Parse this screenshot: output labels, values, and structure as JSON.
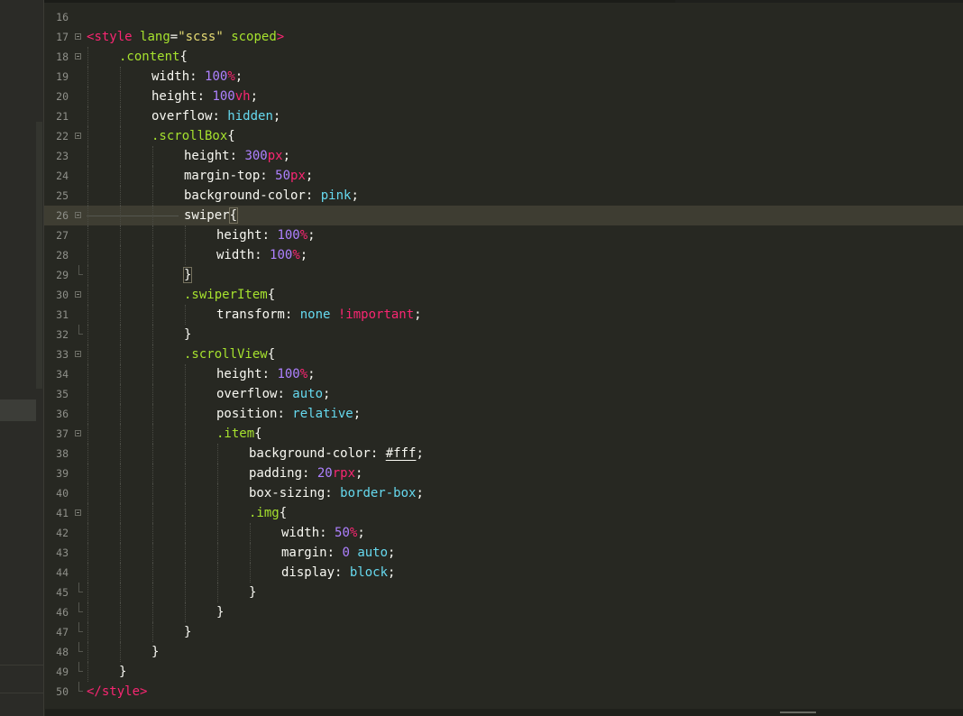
{
  "editor": {
    "current_line": 26,
    "lines": [
      {
        "n": "16",
        "fold": "none",
        "indent": 0,
        "tokens": []
      },
      {
        "n": "17",
        "fold": "open",
        "indent": 0,
        "tokens": [
          [
            "<",
            "t-tag"
          ],
          [
            "style",
            "t-tag"
          ],
          [
            " ",
            ""
          ],
          [
            "lang",
            "t-attr"
          ],
          [
            "=",
            ""
          ],
          [
            "\"scss\"",
            "t-str"
          ],
          [
            " ",
            ""
          ],
          [
            "scoped",
            "t-attr"
          ],
          [
            ">",
            "t-tag"
          ]
        ]
      },
      {
        "n": "18",
        "fold": "open",
        "indent": 1,
        "tokens": [
          [
            ".content",
            "t-sel"
          ],
          [
            "{",
            ""
          ]
        ]
      },
      {
        "n": "19",
        "fold": "none",
        "indent": 2,
        "tokens": [
          [
            "width",
            "t-prop"
          ],
          [
            ": ",
            ""
          ],
          [
            "100",
            "t-num"
          ],
          [
            "%",
            "t-unit"
          ],
          [
            ";",
            ""
          ]
        ]
      },
      {
        "n": "20",
        "fold": "none",
        "indent": 2,
        "tokens": [
          [
            "height",
            "t-prop"
          ],
          [
            ": ",
            ""
          ],
          [
            "100",
            "t-num"
          ],
          [
            "vh",
            "t-unit"
          ],
          [
            ";",
            ""
          ]
        ]
      },
      {
        "n": "21",
        "fold": "none",
        "indent": 2,
        "tokens": [
          [
            "overflow",
            "t-prop"
          ],
          [
            ": ",
            ""
          ],
          [
            "hidden",
            "t-kw"
          ],
          [
            ";",
            ""
          ]
        ]
      },
      {
        "n": "22",
        "fold": "open",
        "indent": 2,
        "tokens": [
          [
            ".scrollBox",
            "t-sel"
          ],
          [
            "{",
            ""
          ]
        ]
      },
      {
        "n": "23",
        "fold": "none",
        "indent": 3,
        "tokens": [
          [
            "height",
            "t-prop"
          ],
          [
            ": ",
            ""
          ],
          [
            "300",
            "t-num"
          ],
          [
            "px",
            "t-unit"
          ],
          [
            ";",
            ""
          ]
        ]
      },
      {
        "n": "24",
        "fold": "none",
        "indent": 3,
        "tokens": [
          [
            "margin-top",
            "t-prop"
          ],
          [
            ": ",
            ""
          ],
          [
            "50",
            "t-num"
          ],
          [
            "px",
            "t-unit"
          ],
          [
            ";",
            ""
          ]
        ]
      },
      {
        "n": "25",
        "fold": "none",
        "indent": 3,
        "tokens": [
          [
            "background-color",
            "t-prop"
          ],
          [
            ": ",
            ""
          ],
          [
            "pink",
            "t-kw"
          ],
          [
            ";",
            ""
          ]
        ]
      },
      {
        "n": "26",
        "fold": "open",
        "indent": 3,
        "tokens": [
          [
            "swiper",
            "t-prop"
          ],
          [
            "{",
            "bracket-box"
          ],
          [
            "",
            "caret"
          ]
        ]
      },
      {
        "n": "27",
        "fold": "none",
        "indent": 4,
        "tokens": [
          [
            "height",
            "t-prop"
          ],
          [
            ": ",
            ""
          ],
          [
            "100",
            "t-num"
          ],
          [
            "%",
            "t-unit"
          ],
          [
            ";",
            ""
          ]
        ]
      },
      {
        "n": "28",
        "fold": "none",
        "indent": 4,
        "tokens": [
          [
            "width",
            "t-prop"
          ],
          [
            ": ",
            ""
          ],
          [
            "100",
            "t-num"
          ],
          [
            "%",
            "t-unit"
          ],
          [
            ";",
            ""
          ]
        ]
      },
      {
        "n": "29",
        "fold": "end",
        "indent": 3,
        "tokens": [
          [
            "}",
            "bracket-box"
          ]
        ]
      },
      {
        "n": "30",
        "fold": "open",
        "indent": 3,
        "tokens": [
          [
            ".swiperItem",
            "t-sel"
          ],
          [
            "{",
            ""
          ]
        ]
      },
      {
        "n": "31",
        "fold": "none",
        "indent": 4,
        "tokens": [
          [
            "transform",
            "t-prop"
          ],
          [
            ": ",
            ""
          ],
          [
            "none",
            "t-kw"
          ],
          [
            " ",
            ""
          ],
          [
            "!important",
            "t-imp"
          ],
          [
            ";",
            ""
          ]
        ]
      },
      {
        "n": "32",
        "fold": "end",
        "indent": 3,
        "tokens": [
          [
            "}",
            ""
          ]
        ]
      },
      {
        "n": "33",
        "fold": "open",
        "indent": 3,
        "tokens": [
          [
            ".scrollView",
            "t-sel"
          ],
          [
            "{",
            ""
          ]
        ]
      },
      {
        "n": "34",
        "fold": "none",
        "indent": 4,
        "tokens": [
          [
            "height",
            "t-prop"
          ],
          [
            ": ",
            ""
          ],
          [
            "100",
            "t-num"
          ],
          [
            "%",
            "t-unit"
          ],
          [
            ";",
            ""
          ]
        ]
      },
      {
        "n": "35",
        "fold": "none",
        "indent": 4,
        "tokens": [
          [
            "overflow",
            "t-prop"
          ],
          [
            ": ",
            ""
          ],
          [
            "auto",
            "t-kw"
          ],
          [
            ";",
            ""
          ]
        ]
      },
      {
        "n": "36",
        "fold": "none",
        "indent": 4,
        "tokens": [
          [
            "position",
            "t-prop"
          ],
          [
            ": ",
            ""
          ],
          [
            "relative",
            "t-kw"
          ],
          [
            ";",
            ""
          ]
        ]
      },
      {
        "n": "37",
        "fold": "open",
        "indent": 4,
        "tokens": [
          [
            ".item",
            "t-sel"
          ],
          [
            "{",
            ""
          ]
        ]
      },
      {
        "n": "38",
        "fold": "none",
        "indent": 5,
        "tokens": [
          [
            "background-color",
            "t-prop"
          ],
          [
            ": ",
            ""
          ],
          [
            "#fff",
            "t-hex"
          ],
          [
            ";",
            ""
          ]
        ]
      },
      {
        "n": "39",
        "fold": "none",
        "indent": 5,
        "tokens": [
          [
            "padding",
            "t-prop"
          ],
          [
            ": ",
            ""
          ],
          [
            "20",
            "t-num"
          ],
          [
            "rpx",
            "t-unit"
          ],
          [
            ";",
            ""
          ]
        ]
      },
      {
        "n": "40",
        "fold": "none",
        "indent": 5,
        "tokens": [
          [
            "box-sizing",
            "t-prop"
          ],
          [
            ": ",
            ""
          ],
          [
            "border-box",
            "t-kw"
          ],
          [
            ";",
            ""
          ]
        ]
      },
      {
        "n": "41",
        "fold": "open",
        "indent": 5,
        "tokens": [
          [
            ".img",
            "t-sel"
          ],
          [
            "{",
            ""
          ]
        ]
      },
      {
        "n": "42",
        "fold": "none",
        "indent": 6,
        "tokens": [
          [
            "width",
            "t-prop"
          ],
          [
            ": ",
            ""
          ],
          [
            "50",
            "t-num"
          ],
          [
            "%",
            "t-unit"
          ],
          [
            ";",
            ""
          ]
        ]
      },
      {
        "n": "43",
        "fold": "none",
        "indent": 6,
        "tokens": [
          [
            "margin",
            "t-prop"
          ],
          [
            ": ",
            ""
          ],
          [
            "0",
            "t-num"
          ],
          [
            " ",
            ""
          ],
          [
            "auto",
            "t-kw"
          ],
          [
            ";",
            ""
          ]
        ]
      },
      {
        "n": "44",
        "fold": "none",
        "indent": 6,
        "tokens": [
          [
            "display",
            "t-prop"
          ],
          [
            ": ",
            ""
          ],
          [
            "block",
            "t-kw"
          ],
          [
            ";",
            ""
          ]
        ]
      },
      {
        "n": "45",
        "fold": "end",
        "indent": 5,
        "tokens": [
          [
            "}",
            ""
          ]
        ]
      },
      {
        "n": "46",
        "fold": "end",
        "indent": 4,
        "tokens": [
          [
            "}",
            ""
          ]
        ]
      },
      {
        "n": "47",
        "fold": "end",
        "indent": 3,
        "tokens": [
          [
            "}",
            ""
          ]
        ]
      },
      {
        "n": "48",
        "fold": "end",
        "indent": 2,
        "tokens": [
          [
            "}",
            ""
          ]
        ]
      },
      {
        "n": "49",
        "fold": "end",
        "indent": 1,
        "tokens": [
          [
            "}",
            ""
          ]
        ]
      },
      {
        "n": "50",
        "fold": "end",
        "indent": 0,
        "tokens": [
          [
            "</",
            "t-tag"
          ],
          [
            "style",
            "t-tag"
          ],
          [
            ">",
            "t-tag"
          ]
        ]
      }
    ]
  }
}
